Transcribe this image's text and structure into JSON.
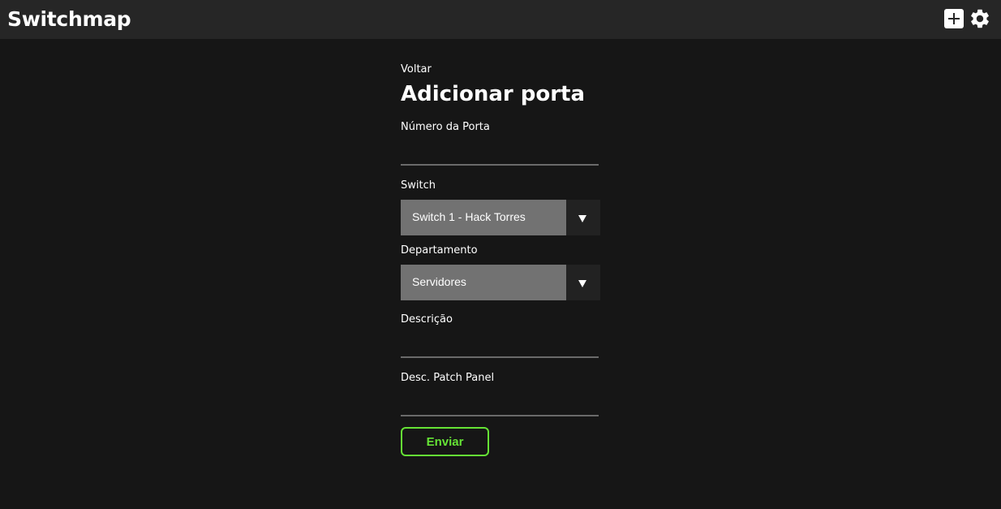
{
  "app": {
    "title": "Switchmap",
    "icons": [
      "add-icon",
      "gear-icon"
    ]
  },
  "form": {
    "back_label": "Voltar",
    "title": "Adicionar porta",
    "port_number": {
      "label": "Número da Porta",
      "value": ""
    },
    "switch": {
      "label": "Switch",
      "selected": "Switch 1 - Hack Torres"
    },
    "department": {
      "label": "Departamento",
      "selected": "Servidores"
    },
    "description": {
      "label": "Descrição",
      "value": ""
    },
    "patch_panel": {
      "label": "Desc. Patch Panel",
      "value": ""
    },
    "submit_label": "Enviar"
  },
  "colors": {
    "background": "#161616",
    "topbar": "#262626",
    "select_bg": "#727272",
    "accent_green": "#65e235"
  }
}
